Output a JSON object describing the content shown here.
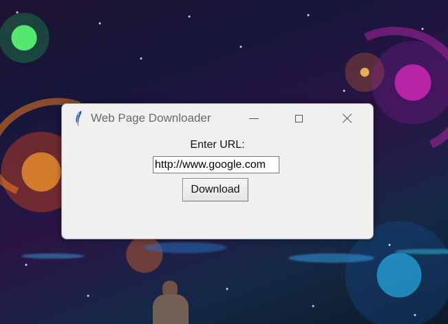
{
  "window": {
    "title": "Web Page Downloader"
  },
  "form": {
    "label": "Enter URL:",
    "url_value": "http://www.google.com",
    "button_label": "Download"
  },
  "icons": {
    "app": "feather-icon",
    "minimize": "minimize-icon",
    "maximize": "maximize-icon",
    "close": "close-icon"
  },
  "colors": {
    "window_background": "#f0f0f0",
    "title_text": "#6a6a6a",
    "label_text": "#111111",
    "input_background": "#ffffff"
  }
}
